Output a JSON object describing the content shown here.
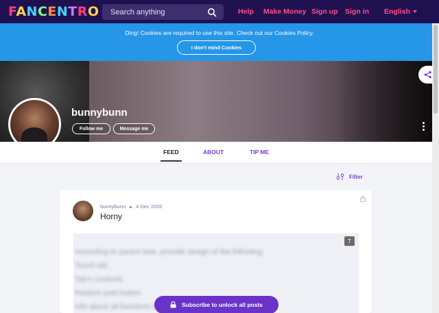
{
  "header": {
    "logo": "FANCENTRO",
    "search_placeholder": "Search anything",
    "nav": [
      "Help",
      "Make Money",
      "Sign up",
      "Sign in"
    ],
    "language": "English",
    "background": "#1f1150",
    "accent": "#ff4f8a"
  },
  "cookie_bar": {
    "message": "Ding! Cookies are required to use this site. Check out our Cookies Policy.",
    "button": "I don't mind Cookies",
    "background": "#2596e8"
  },
  "profile": {
    "username": "bunnybunn",
    "follow_label": "Follow me",
    "message_label": "Message me",
    "tabs": [
      "FEED",
      "ABOUT",
      "TIP ME"
    ],
    "active_tab": "FEED"
  },
  "feed": {
    "filter_label": "Filter",
    "post": {
      "author": "bunnybunn",
      "date": "4 Dec 2020",
      "title": "Horny",
      "t_button": "T",
      "blurred_lines": [
        "According to parent task, provide design of the following:",
        "Touch tab",
        "Tab's contents",
        "Restore post button",
        "Info about all functions that should be implemented on this"
      ]
    },
    "subscribe_label": "Subscribe to unlock all posts",
    "subscribe_color": "#6a32c9"
  }
}
